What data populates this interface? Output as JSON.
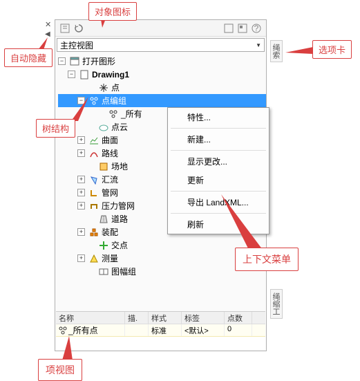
{
  "callouts": {
    "object_icon": "对象图标",
    "auto_hide": "自动隐藏",
    "tree_structure": "树结构",
    "tab": "选项卡",
    "context_menu": "上下文菜单",
    "item_view": "项视图"
  },
  "dropdown": {
    "selected": "主控视图"
  },
  "side_tab1": "绳索",
  "side_tab2": "绳缩工",
  "tree": {
    "root": "打开图形",
    "drawing": "Drawing1",
    "nodes": {
      "point": "点",
      "point_group": "点编组",
      "all_points": "_所有",
      "point_cloud": "点云",
      "surface": "曲面",
      "route": "路线",
      "site": "场地",
      "catchment": "汇流",
      "pipe_network": "管网",
      "pressure_network": "压力管网",
      "road": "道路",
      "assembly": "装配",
      "intersection": "交点",
      "survey": "测量",
      "view_frame": "图幅组"
    }
  },
  "context_menu": {
    "properties": "特性...",
    "new": "新建...",
    "show_changes": "显示更改...",
    "update": "更新",
    "export_landxml": "导出 LandXML...",
    "refresh": "刷新"
  },
  "grid": {
    "headers": {
      "name": "名称",
      "desc": "描.",
      "style": "样式",
      "label": "标签",
      "pts": "点数"
    },
    "row1": {
      "name": "_所有点",
      "style": "标准",
      "label": "<默认>",
      "pts": "0"
    }
  }
}
